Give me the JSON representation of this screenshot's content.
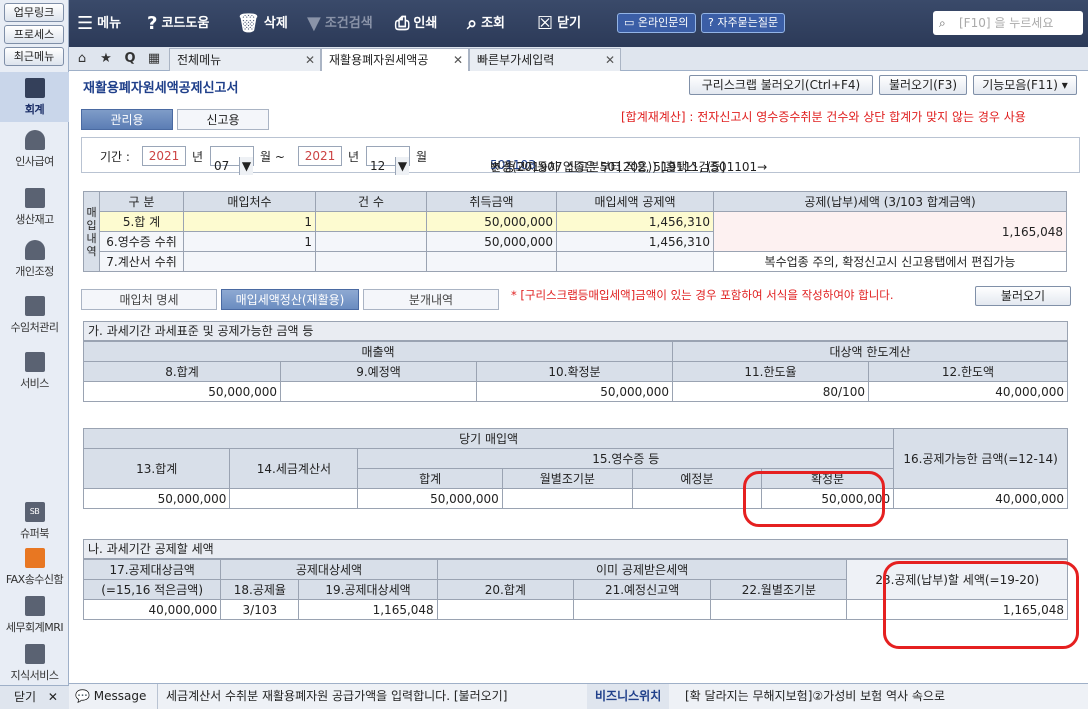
{
  "left": {
    "links": [
      "업무링크",
      "프로세스",
      "최근메뉴"
    ],
    "items": [
      "회계",
      "인사급여",
      "생산재고",
      "개인조정",
      "수임처관리",
      "서비스"
    ],
    "bottom_items": [
      "슈퍼북",
      "FAX송수신함",
      "세무회계MRI",
      "지식서비스"
    ],
    "sb_badge": "SB",
    "close_label": "닫기"
  },
  "toolbar": {
    "menu": "메뉴",
    "code_help": "코드도움",
    "delete": "삭제",
    "filter": "조건검색",
    "print": "인쇄",
    "lookup": "조회",
    "close": "닫기",
    "inquiry": "온라인문의",
    "faq": "자주묻는질문",
    "search_placeholder": "[F10] 을 누르세요"
  },
  "tabs": [
    "전체메뉴",
    "재활용폐자원세액공",
    "빠른부가세입력"
  ],
  "page": {
    "title": "재활용폐자원세액공제신고서",
    "btn_scrap": "구리스크랩 불러오기(Ctrl+F4)",
    "btn_load": "불러오기(F3)",
    "btn_func": "기능모음(F11)",
    "tab_admin": "관리용",
    "tab_report": "신고용",
    "notice_recalc": "[합계재계산] : 전자신고시 영수증수취분 건수와 상단 합계가 맞지 않는 경우 사용"
  },
  "period": {
    "label": "기간 :",
    "from_year": "2021",
    "year_unit1": "년",
    "from_month": "07",
    "month_unit1": "월 ~",
    "to_year": "2021",
    "year_unit2": "년",
    "to_month": "12",
    "month_unit2": "월",
    "note_prefix": "※ 중고자동차 업종은 501202, 519111, (501101→",
    "note_code": "501103",
    "note_suffix": "변경(201907 신고분부터 적용)) [홈택스검증]"
  },
  "summary": {
    "side_label": [
      "매",
      "입",
      "내",
      "역"
    ],
    "headers": [
      "구 분",
      "매입처수",
      "건 수",
      "취득금액",
      "매입세액 공제액",
      "공제(납부)세액 (3/103 합계금액)"
    ],
    "rows": [
      {
        "name": "5.합   계",
        "vendors": "1",
        "count": "",
        "amount": "50,000,000",
        "tax": "1,456,310"
      },
      {
        "name": "6.영수증 수취",
        "vendors": "1",
        "count": "",
        "amount": "50,000,000",
        "tax": "1,456,310"
      },
      {
        "name": "7.계산서 수취",
        "vendors": "",
        "count": "",
        "amount": "",
        "tax": ""
      }
    ],
    "deduction": "1,165,048",
    "note": "복수업종 주의, 확정신고시 신고용탭에서 편집가능"
  },
  "subtabs": {
    "vendor": "매입처 명세",
    "settlement": "매입세액정산(재활용)",
    "journal": "분개내역",
    "warning": "* [구리스크랩등매입세액]금액이 있는 경우 포함하여 서식을 작성하여야 합니다.",
    "load": "불러오기"
  },
  "section_a": {
    "title": "가. 과세기간 과세표준 및 공제가능한 금액 등",
    "sales": "매출액",
    "limit": "대상액 한도계산",
    "cols": [
      "8.합계",
      "9.예정액",
      "10.확정분",
      "11.한도율",
      "12.한도액"
    ],
    "vals": [
      "50,000,000",
      "",
      "50,000,000",
      "80/100",
      "40,000,000"
    ]
  },
  "section_b": {
    "purchase": "당기 매입액",
    "c13": "13.합계",
    "c14": "14.세금계산서",
    "c15": "15.영수증 등",
    "c16": "16.공제가능한 금액(=12-14)",
    "sub": [
      "합계",
      "월별조기분",
      "예정분",
      "확정분"
    ],
    "v13": "50,000,000",
    "v14": "",
    "vals": [
      "50,000,000",
      "",
      "",
      "50,000,000"
    ],
    "v16": "40,000,000"
  },
  "section_c": {
    "title": "나. 과세기간 공제할 세액",
    "c17": "17.공제대상금액",
    "c17b": "(=15,16 적은금액)",
    "target": "공제대상세액",
    "c18": "18.공제율",
    "c19": "19.공제대상세액",
    "already": "이미 공제받은세액",
    "c20": "20.합계",
    "c21": "21.예정신고액",
    "c22": "22.월별조기분",
    "c23": "23.공제(납부)할 세액(=19-20)",
    "v17": "40,000,000",
    "v18": "3/103",
    "v19": "1,165,048",
    "v20": "",
    "v21": "",
    "v22": "",
    "v23": "1,165,048"
  },
  "status": {
    "message_label": "Message",
    "message": "세금계산서 수취분 재활용폐자원 공급가액을 입력합니다. [불러오기]",
    "biz_label": "비즈니스위치",
    "biz_text": "[확 달라지는 무해지보험]②가성비 보험 역사 속으로"
  }
}
